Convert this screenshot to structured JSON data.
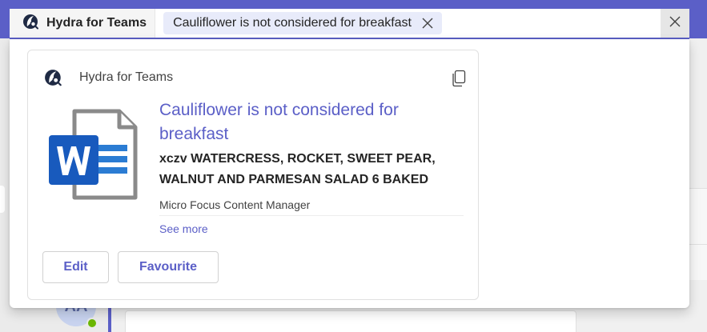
{
  "search": {
    "app_name": "Hydra for Teams",
    "query": "Cauliflower is not considered for breakfast"
  },
  "result_card": {
    "app_label": "Hydra for Teams",
    "title": "Cauliflower is not considered for breakfast",
    "subtitle": "xczv WATERCRESS, ROCKET, SWEET PEAR, WALNUT AND PARMESAN SALAD 6 BAKED",
    "source": "Micro Focus Content Manager",
    "see_more": "See more",
    "doc_icon": "word-document-icon",
    "actions": {
      "edit": "Edit",
      "favourite": "Favourite"
    }
  },
  "background": {
    "avatar_initials": "AA"
  },
  "colors": {
    "accent": "#5b5fc7",
    "pill_bg": "#e8ebfa",
    "word_blue": "#185abd"
  }
}
